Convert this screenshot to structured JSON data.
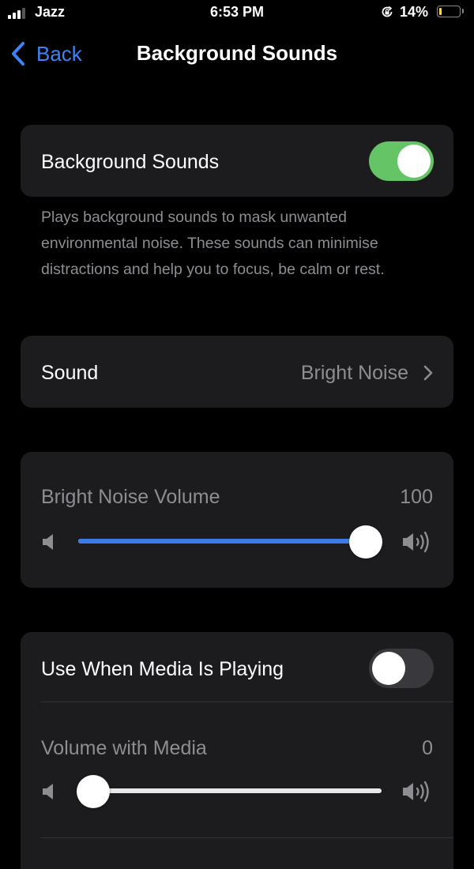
{
  "status_bar": {
    "carrier": "Jazz",
    "time": "6:53 PM",
    "battery_percent": "14%",
    "signal_bars": 3,
    "signal_bars_total": 4,
    "orientation_lock_icon": "orientation-lock-icon",
    "battery_color": "#f5d74a"
  },
  "nav": {
    "back_label": "Back",
    "title": "Background Sounds",
    "accent": "#3d83f3"
  },
  "background_sounds": {
    "label": "Background Sounds",
    "enabled": true,
    "toggle_on_color": "#65c466",
    "description": "Plays background sounds to mask unwanted environmental noise. These sounds can minimise distractions and help you to focus, be calm or rest."
  },
  "sound": {
    "label": "Sound",
    "value": "Bright Noise"
  },
  "volume": {
    "label": "Bright Noise Volume",
    "value_text": "100",
    "value": 100,
    "min": 0,
    "max": 100,
    "fill_color": "#3d7ce8",
    "min_icon": "speaker-low-icon",
    "max_icon": "speaker-high-icon"
  },
  "media": {
    "label": "Use When Media Is Playing",
    "enabled": false,
    "volume_label": "Volume with Media",
    "volume_value_text": "0",
    "volume_value": 0,
    "min": 0,
    "max": 100
  }
}
